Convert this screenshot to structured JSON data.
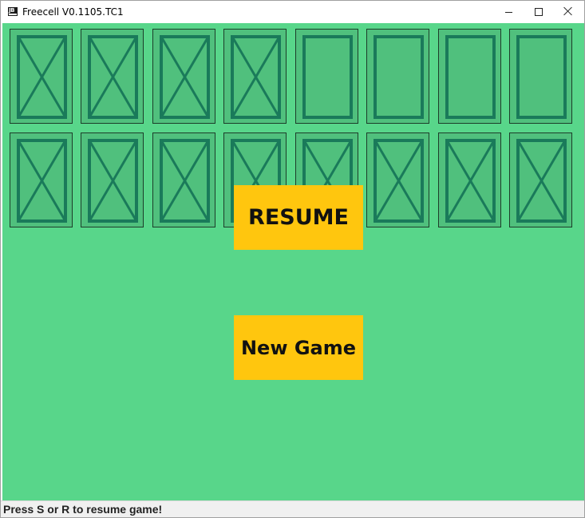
{
  "window": {
    "title": "Freecell V0.1105.TC1",
    "app_icon_text": "JB"
  },
  "title_controls": {
    "minimize_icon": "minimize-icon",
    "maximize_icon": "maximize-icon",
    "close_icon": "close-icon"
  },
  "board": {
    "background_color": "#58d68a",
    "slot_fill_color": "#50c07d",
    "slot_line_color": "#1a7a5a",
    "top_row": [
      {
        "marked": true
      },
      {
        "marked": true
      },
      {
        "marked": true
      },
      {
        "marked": true
      },
      {
        "marked": false
      },
      {
        "marked": false
      },
      {
        "marked": false
      },
      {
        "marked": false
      }
    ],
    "bottom_row": [
      {
        "marked": true
      },
      {
        "marked": true
      },
      {
        "marked": true
      },
      {
        "marked": true
      },
      {
        "marked": true
      },
      {
        "marked": true
      },
      {
        "marked": true
      },
      {
        "marked": true
      }
    ]
  },
  "menu": {
    "resume_label": "RESUME",
    "new_game_label": "New Game",
    "button_color": "#ffc60e"
  },
  "status": {
    "message": "Press S or R to resume game!"
  }
}
